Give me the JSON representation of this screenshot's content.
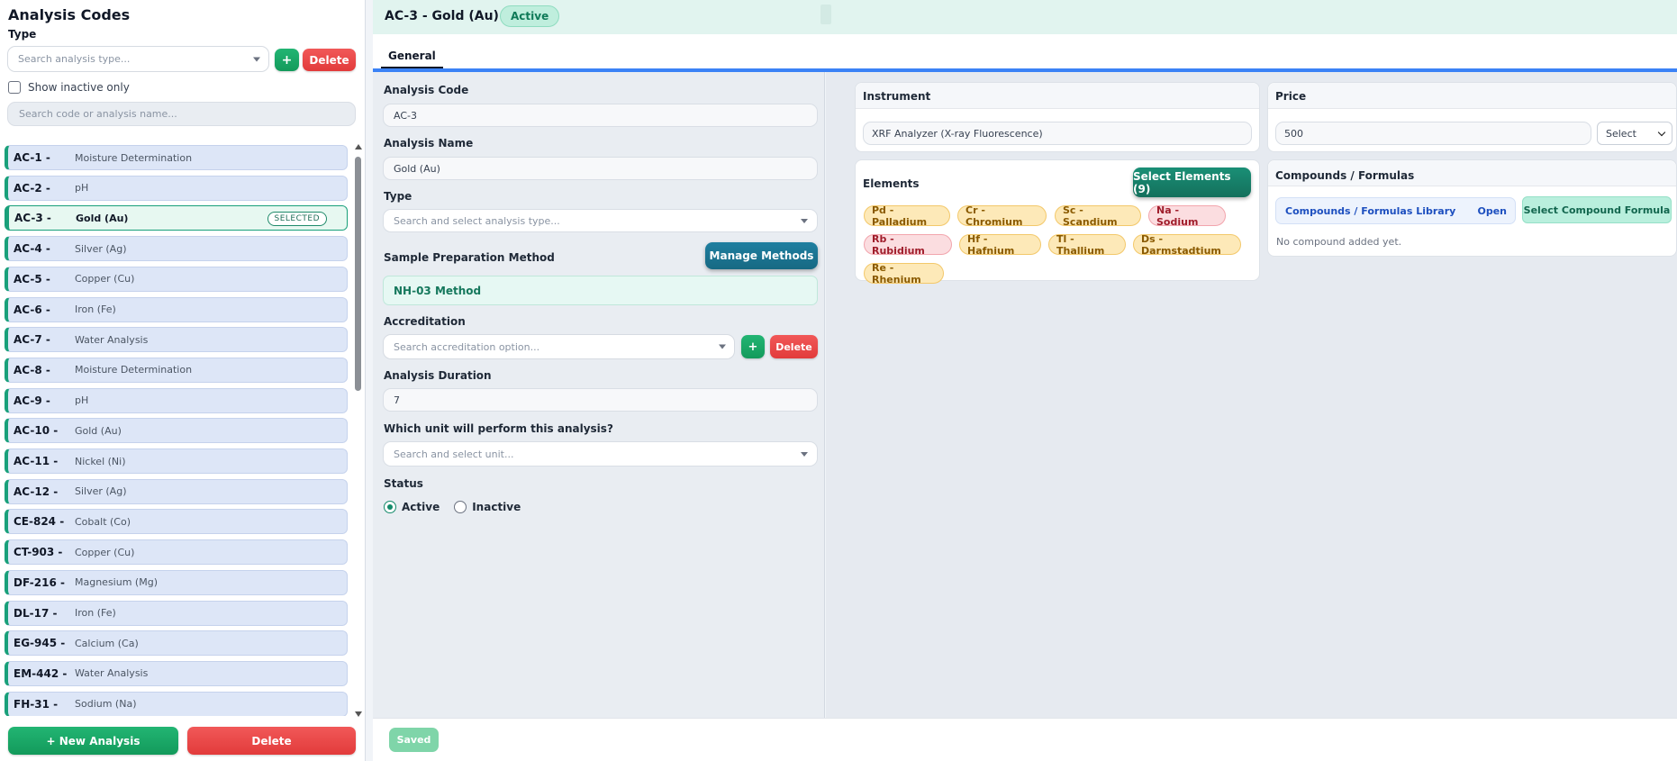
{
  "sidebar": {
    "title": "Analysis Codes",
    "type_label": "Type",
    "type_placeholder": "Search analysis type...",
    "add_label": "+",
    "delete_label": "Delete",
    "show_inactive_label": "Show inactive only",
    "search_placeholder": "Search code or analysis name...",
    "selected_badge": "SELECTED",
    "new_analysis_label": "+ New Analysis",
    "footer_delete_label": "Delete",
    "items": [
      {
        "code": "AC-1 -",
        "name": "Moisture Determination"
      },
      {
        "code": "AC-2 -",
        "name": "pH"
      },
      {
        "code": "AC-3 -",
        "name": "Gold (Au)",
        "selected": true
      },
      {
        "code": "AC-4 -",
        "name": "Silver (Ag)"
      },
      {
        "code": "AC-5 -",
        "name": "Copper (Cu)"
      },
      {
        "code": "AC-6 -",
        "name": "Iron (Fe)"
      },
      {
        "code": "AC-7 -",
        "name": "Water Analysis"
      },
      {
        "code": "AC-8 -",
        "name": "Moisture Determination"
      },
      {
        "code": "AC-9 -",
        "name": "pH"
      },
      {
        "code": "AC-10 -",
        "name": "Gold (Au)"
      },
      {
        "code": "AC-11 -",
        "name": "Nickel (Ni)"
      },
      {
        "code": "AC-12 -",
        "name": "Silver (Ag)"
      },
      {
        "code": "CE-824 -",
        "name": "Cobalt (Co)"
      },
      {
        "code": "CT-903 -",
        "name": "Copper (Cu)"
      },
      {
        "code": "DF-216 -",
        "name": "Magnesium (Mg)"
      },
      {
        "code": "DL-17 -",
        "name": "Iron (Fe)"
      },
      {
        "code": "EG-945 -",
        "name": "Calcium (Ca)"
      },
      {
        "code": "EM-442 -",
        "name": "Water Analysis"
      },
      {
        "code": "FH-31 -",
        "name": "Sodium (Na)"
      }
    ]
  },
  "header": {
    "title": "AC-3 - Gold (Au)",
    "status": "Active",
    "tabs": [
      {
        "label": "General"
      }
    ]
  },
  "form": {
    "analysis_code_label": "Analysis Code",
    "analysis_code_value": "AC-3",
    "analysis_name_label": "Analysis Name",
    "analysis_name_value": "Gold (Au)",
    "type_label": "Type",
    "type_placeholder": "Search and select analysis type...",
    "prep_method_label": "Sample Preparation Method",
    "manage_methods_label": "Manage Methods",
    "prep_method_value": "NH-03 Method",
    "accreditation_label": "Accreditation",
    "accreditation_placeholder": "Search accreditation option...",
    "accreditation_add_label": "+",
    "accreditation_delete_label": "Delete",
    "duration_label": "Analysis Duration",
    "duration_value": "7",
    "unit_label": "Which unit will perform this analysis?",
    "unit_placeholder": "Search and select unit...",
    "status_label": "Status",
    "status_active": "Active",
    "status_inactive": "Inactive",
    "status_selected": "Active"
  },
  "instrument": {
    "title": "Instrument",
    "value": "XRF Analyzer (X-ray Fluorescence)"
  },
  "price": {
    "title": "Price",
    "value": "500",
    "currency_select": "Select"
  },
  "elements": {
    "title": "Elements",
    "select_button": "Select Elements (9)",
    "tags": [
      {
        "label": "Pd - Palladium",
        "tone": "amber"
      },
      {
        "label": "Cr - Chromium",
        "tone": "amber"
      },
      {
        "label": "Sc - Scandium",
        "tone": "amber"
      },
      {
        "label": "Na - Sodium",
        "tone": "rose"
      },
      {
        "label": "Rb - Rubidium",
        "tone": "rose"
      },
      {
        "label": "Hf - Hafnium",
        "tone": "amber"
      },
      {
        "label": "Tl - Thallium",
        "tone": "amber"
      },
      {
        "label": "Ds - Darmstadtium",
        "tone": "amber"
      },
      {
        "label": "Re - Rhenium",
        "tone": "amber"
      }
    ]
  },
  "compounds": {
    "title": "Compounds / Formulas",
    "library_label": "Compounds / Formulas Library",
    "open_label": "Open",
    "select_button": "Select Compound Formula",
    "empty_text": "No compound added yet."
  },
  "footer": {
    "saved_label": "Saved"
  },
  "colors": {
    "accent_green": "#19a07a",
    "danger_red": "#e23b3b",
    "teal_button": "#176983",
    "tab_underline": "#3b82f6"
  }
}
